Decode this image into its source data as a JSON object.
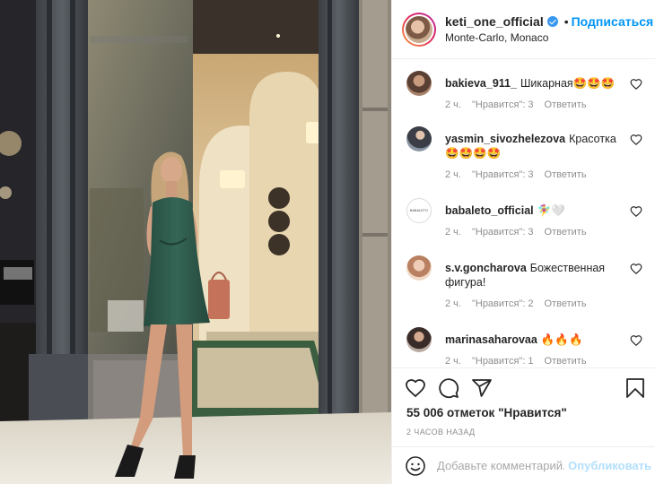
{
  "post": {
    "author": {
      "username": "keti_one_official",
      "verified": true,
      "separator": "•",
      "follow_label": "Подписаться",
      "location": "Monte-Carlo, Monaco"
    },
    "more_icon": "more-horizontal-icon",
    "comments": [
      {
        "username": "bakieva_911_",
        "text": "Шикарная🤩🤩🤩",
        "time": "2 ч.",
        "likes": "\"Нравится\": 3",
        "reply": "Ответить"
      },
      {
        "username": "yasmin_sivozhelezova",
        "text": "Красотка 🤩🤩🤩🤩",
        "time": "2 ч.",
        "likes": "\"Нравится\": 3",
        "reply": "Ответить"
      },
      {
        "username": "babaleto_official",
        "text": "🧚‍♀️🤍",
        "time": "2 ч.",
        "likes": "\"Нравится\": 3",
        "reply": "Ответить",
        "avatar_text": "BABALETO"
      },
      {
        "username": "s.v.goncharova",
        "text": "Божественная фигура!",
        "time": "2 ч.",
        "likes": "\"Нравится\": 2",
        "reply": "Ответить"
      },
      {
        "username": "marinasaharovaa",
        "text": "🔥🔥🔥",
        "time": "2 ч.",
        "likes": "\"Нравится\": 1",
        "reply": "Ответить"
      }
    ],
    "likes_text": "55 006 отметок \"Нравится\"",
    "time_ago": "2 ЧАСОВ НАЗАД",
    "comment_placeholder": "Добавьте комментарий...",
    "publish_label": "Опубликовать"
  },
  "colors": {
    "accent": "#0095f6",
    "publish_disabled": "#b2dffc",
    "muted": "#8e8e8e",
    "dress": "#2f5a4c"
  }
}
